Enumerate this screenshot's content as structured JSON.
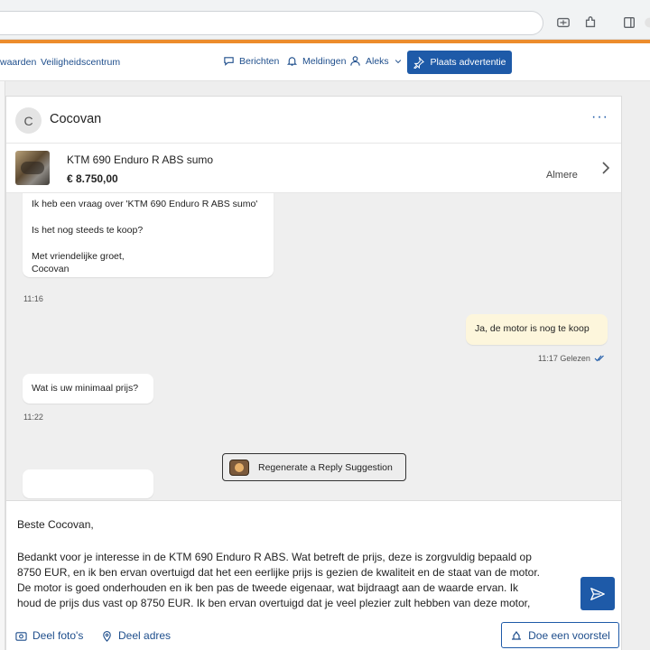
{
  "header": {
    "links": [
      "waarden",
      "Veiligheidscentrum"
    ],
    "messages_label": "Berichten",
    "notifications_label": "Meldingen",
    "user_label": "Aleks",
    "place_ad_label": "Plaats advertentie"
  },
  "conversation": {
    "avatar_initial": "C",
    "name": "Cocovan",
    "more_label": "···"
  },
  "listing": {
    "title": "KTM 690 Enduro R ABS sumo",
    "price": "€ 8.750,00",
    "location": "Almere"
  },
  "messages": [
    {
      "direction": "in",
      "lines": [
        "Ik heb een vraag over 'KTM 690 Enduro R ABS sumo'",
        "Is het nog steeds te koop?",
        "Met vriendelijke groet,",
        "Cocovan"
      ],
      "time": "11:16"
    },
    {
      "direction": "out",
      "lines": [
        "Ja, de motor is nog te koop"
      ],
      "time": "11:17 Gelezen"
    },
    {
      "direction": "in",
      "lines": [
        "Wat is uw minimaal prijs?"
      ],
      "time": "11:22"
    }
  ],
  "regenerate_label": "Regenerate a Reply Suggestion",
  "reply": {
    "greeting": "Beste Cocovan,",
    "lines": [
      "Bedankt voor je interesse in de KTM 690 Enduro R ABS. Wat betreft de prijs, deze is zorgvuldig bepaald op",
      "8750 EUR, en ik ben ervan overtuigd dat het een eerlijke prijs is gezien de kwaliteit en de staat van de motor.",
      "De motor is goed onderhouden en ik ben pas de tweede eigenaar, wat bijdraagt aan de waarde ervan. Ik",
      "houd de prijs dus vast op 8750 EUR. Ik ben ervan overtuigd dat je veel plezier zult hebben van deze motor,"
    ]
  },
  "footer": {
    "share_photos_label": "Deel foto's",
    "share_address_label": "Deel adres",
    "offer_label": "Doe een voorstel"
  },
  "colors": {
    "brand_blue": "#1e5aa8",
    "accent_orange": "#ec8c2c",
    "outgoing_bubble": "#fdf6dc"
  }
}
